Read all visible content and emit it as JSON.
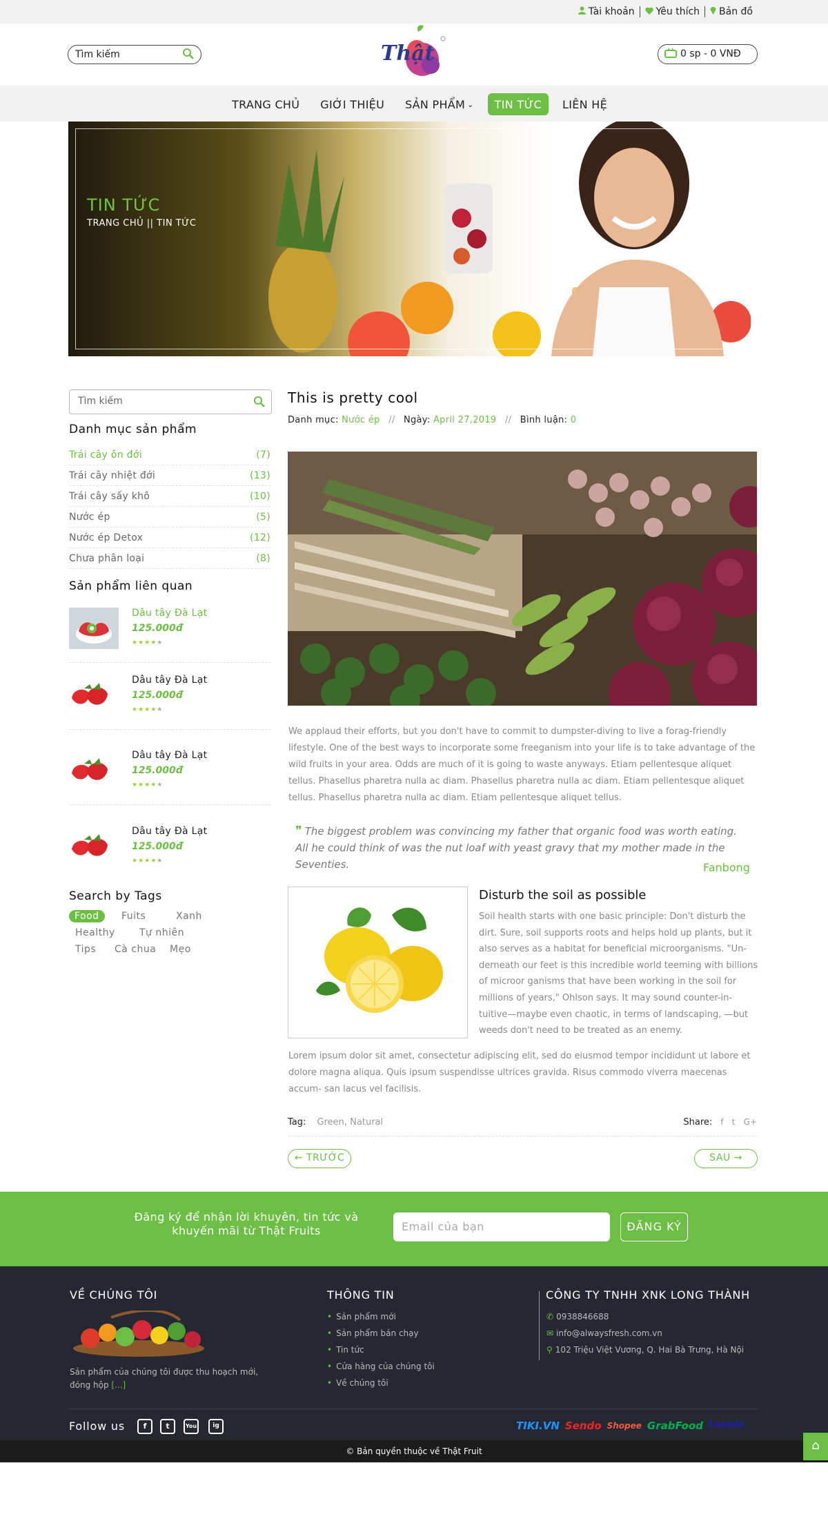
{
  "topbar": {
    "account": "Tài khoản",
    "wishlist": "Yêu thích",
    "map": "Bản đồ"
  },
  "header": {
    "search_placeholder": "Tìm kiếm",
    "logo_text": "Thật",
    "cart": "0 sp - 0 VNĐ"
  },
  "nav": {
    "items": [
      "TRANG CHỦ",
      "GIỚI THIỆU",
      "SẢN PHẨM",
      "TIN TỨC",
      "LIÊN HỆ"
    ],
    "active": "TIN TỨC"
  },
  "banner": {
    "title": "TIN TỨC",
    "breadcrumb": "TRANG CHỦ || TIN TỨC"
  },
  "sidebar": {
    "search_placeholder": "Tìm kiếm",
    "categories_title": "Danh mục sản phẩm",
    "categories": [
      {
        "name": "Trái cây ôn đới",
        "count": "(7)"
      },
      {
        "name": "Trái cây nhiệt đới",
        "count": "(13)"
      },
      {
        "name": "Trái cây sấy khô",
        "count": "(10)"
      },
      {
        "name": "Nước ép",
        "count": "(5)"
      },
      {
        "name": "Nước ép Detox",
        "count": "(12)"
      },
      {
        "name": "Chưa phân loại",
        "count": "(8)"
      }
    ],
    "related_title": "Sản phẩm liên quan",
    "related": [
      {
        "name": "Dâu tây Đà Lạt",
        "price": "125.000đ",
        "rating": 4
      },
      {
        "name": "Dâu tây Đà Lạt",
        "price": "125.000đ",
        "rating": 4
      },
      {
        "name": "Dâu tây Đà Lạt",
        "price": "125.000đ",
        "rating": 4
      },
      {
        "name": "Dâu tây Đà Lạt",
        "price": "125.000đ",
        "rating": 4
      }
    ],
    "tags_title": "Search by Tags",
    "tags": [
      "Food",
      "Fuits",
      "Xanh",
      "Healthy",
      "Tự nhiên",
      "Tips",
      "Cà chua",
      "Mẹo"
    ]
  },
  "article": {
    "title": "This is pretty cool",
    "meta": {
      "category_label": "Danh mục:",
      "category": "Nước ép",
      "date_label": "Ngày:",
      "date": "April 27,2019",
      "comments_label": "Bình luận:",
      "comments": "0"
    },
    "paragraph1": "We applaud their efforts, but you don't have to commit to dumpster-diving to live a forag-friendly lifestyle. One of the best ways to incorporate some freeganism into your life is to take advantage of the wild fruits in your area. Odds are much of it is going to waste anyways. Etiam pellentesque aliquet tellus. Phasellus pharetra nulla ac diam. Phasellus pharetra nulla ac diam. Etiam pellentesque aliquet tellus. Phasellus pharetra nulla ac diam. Etiam pellentesque aliquet tellus.",
    "quote": "The biggest problem was convincing my father that organic food was worth eating. All he could think of was the nut loaf with yeast gravy that my mother made in the Seventies.",
    "quote_author": "Fanbong",
    "sub_title": "Disturb the soil as possible",
    "sub_text": "Soil health starts with one basic principle: Don't disturb the dirt. Sure, soil supports roots and helps hold up plants, but it also serves as a habitat for beneficial microorganisms. \"Un- derneath our feet is this incredible world teeming with billions of microor ganisms that have been working in the soil for millions of years,\" Ohlson says. It may sound counter-in- tuitive—maybe even chaotic, in terms of landscaping, —but weeds don't need to be treated as an enemy.",
    "paragraph2": "Lorem ipsum dolor sit amet, consectetur adipiscing elit, sed do eiusmod tempor incididunt ut labore et dolore magna aliqua. Quis ipsum suspendisse ultrices gravida. Risus commodo viverra maecenas accum- san lacus vel facilisis.",
    "tag_label": "Tag:",
    "tag_values": "Green, Natural",
    "share_label": "Share:",
    "share_icons": [
      "f",
      "t",
      "G+"
    ],
    "prev": "← TRƯỚC",
    "next": "SAU →"
  },
  "newsletter": {
    "text": "Đăng ký để nhận lời khuyên, tin tức và khuyến mãi từ Thật Fruits",
    "placeholder": "Email của bạn",
    "button": "ĐĂNG KÝ"
  },
  "footer": {
    "about_title": "VỀ CHÚNG TÔI",
    "about_text": "Sản phẩm của chúng tôi được thu hoạch mới, đóng hộp",
    "about_more": "[...]",
    "info_title": "THÔNG TIN",
    "info_links": [
      "Sản phẩm mới",
      "Sản phẩm bán chạy",
      "Tin tức",
      "Cửa hàng của chúng tôi",
      "Về chúng tôi"
    ],
    "company_title": "CÔNG TY TNHH XNK LONG THÀNH",
    "phone": "0938846688",
    "email": "info@alwaysfresh.com.vn",
    "address": "102 Triệu Việt Vương, Q. Hai Bà Trưng, Hà Nội",
    "follow": "Follow us",
    "social": [
      "f",
      "t",
      "You",
      "ig"
    ],
    "partners": [
      "TIKI.VN",
      "Sendo",
      "Shopee",
      "GrabFood",
      "Lazada"
    ],
    "copyright": "© Bản quyền thuộc về Thật Fruit"
  },
  "colors": {
    "accent": "#6dbe45",
    "footer_bg": "#252833"
  }
}
